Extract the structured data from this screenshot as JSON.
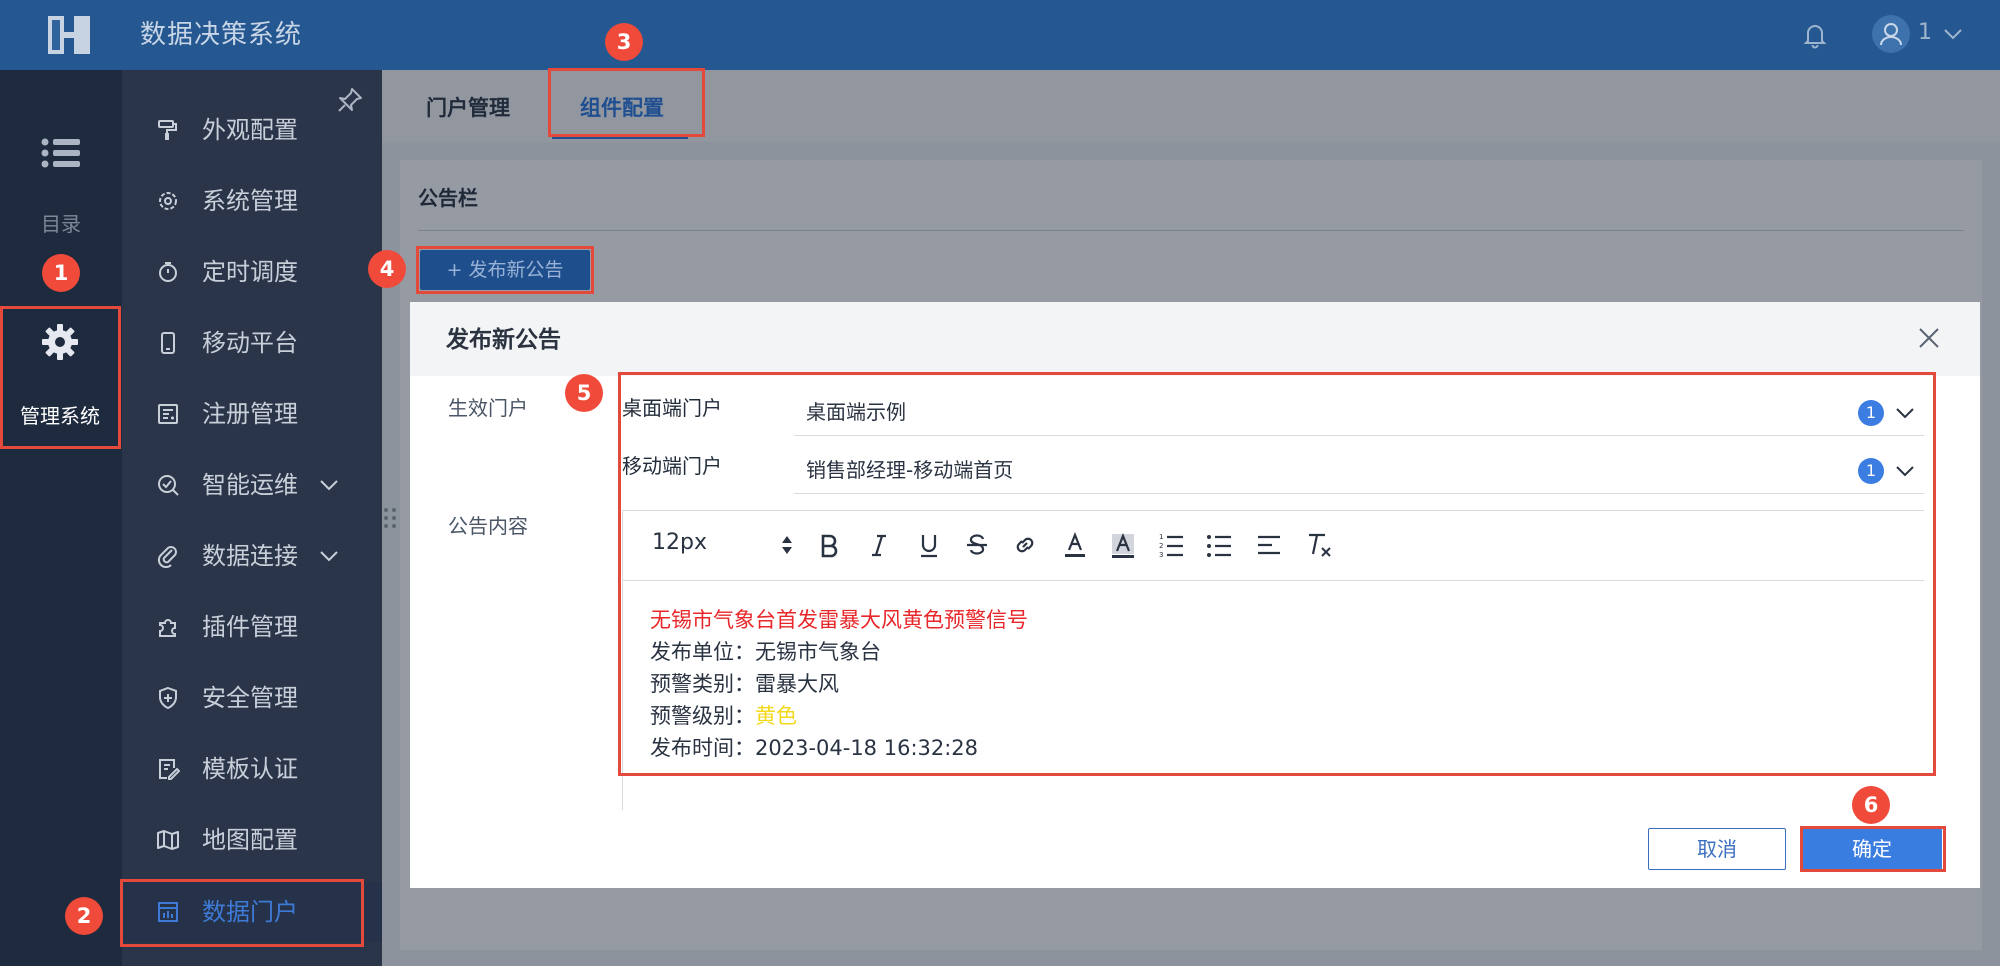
{
  "topbar": {
    "app_title": "数据决策系统",
    "user_name": "1"
  },
  "rail": {
    "catalog_label": "目录",
    "admin_label": "管理系统"
  },
  "menu": {
    "items": [
      {
        "label": "外观配置",
        "icon": "paint-roller-icon"
      },
      {
        "label": "系统管理",
        "icon": "gear-icon"
      },
      {
        "label": "定时调度",
        "icon": "stopwatch-icon"
      },
      {
        "label": "移动平台",
        "icon": "mobile-icon"
      },
      {
        "label": "注册管理",
        "icon": "register-icon"
      },
      {
        "label": "智能运维",
        "icon": "ops-icon",
        "expandable": true
      },
      {
        "label": "数据连接",
        "icon": "paperclip-icon",
        "expandable": true
      },
      {
        "label": "插件管理",
        "icon": "puzzle-icon"
      },
      {
        "label": "安全管理",
        "icon": "shield-icon"
      },
      {
        "label": "模板认证",
        "icon": "certificate-icon"
      },
      {
        "label": "地图配置",
        "icon": "map-icon"
      },
      {
        "label": "数据门户",
        "icon": "portal-chart-icon",
        "active": true
      }
    ]
  },
  "tabs": {
    "portal": "门户管理",
    "component": "组件配置",
    "active": "组件配置"
  },
  "panel": {
    "title": "公告栏",
    "publish_button": "+ 发布新公告"
  },
  "dialog": {
    "title": "发布新公告",
    "effective_label": "生效门户",
    "content_label": "公告内容",
    "desktop_label": "桌面端门户",
    "desktop_value": "桌面端示例",
    "desktop_count": "1",
    "mobile_label": "移动端门户",
    "mobile_value": "销售部经理-移动端首页",
    "mobile_count": "1",
    "editor": {
      "font_size": "12px",
      "title_line": "无锡市气象台首发雷暴大风黄色预警信号",
      "line1": "发布单位：无锡市气象台",
      "line2": "预警类别：雷暴大风",
      "line3_prefix": "预警级别：",
      "line3_value": "黄色",
      "line4": "发布时间：2023-04-18 16:32:28"
    },
    "cancel_button": "取消",
    "ok_button": "确定"
  },
  "steps": [
    "1",
    "2",
    "3",
    "4",
    "5",
    "6"
  ],
  "colors": {
    "topbar": "#255790",
    "accent": "#3a7de0",
    "annotation": "#e34a3c",
    "warning_red": "#e8272a",
    "warning_yellow": "#f4d81a"
  }
}
